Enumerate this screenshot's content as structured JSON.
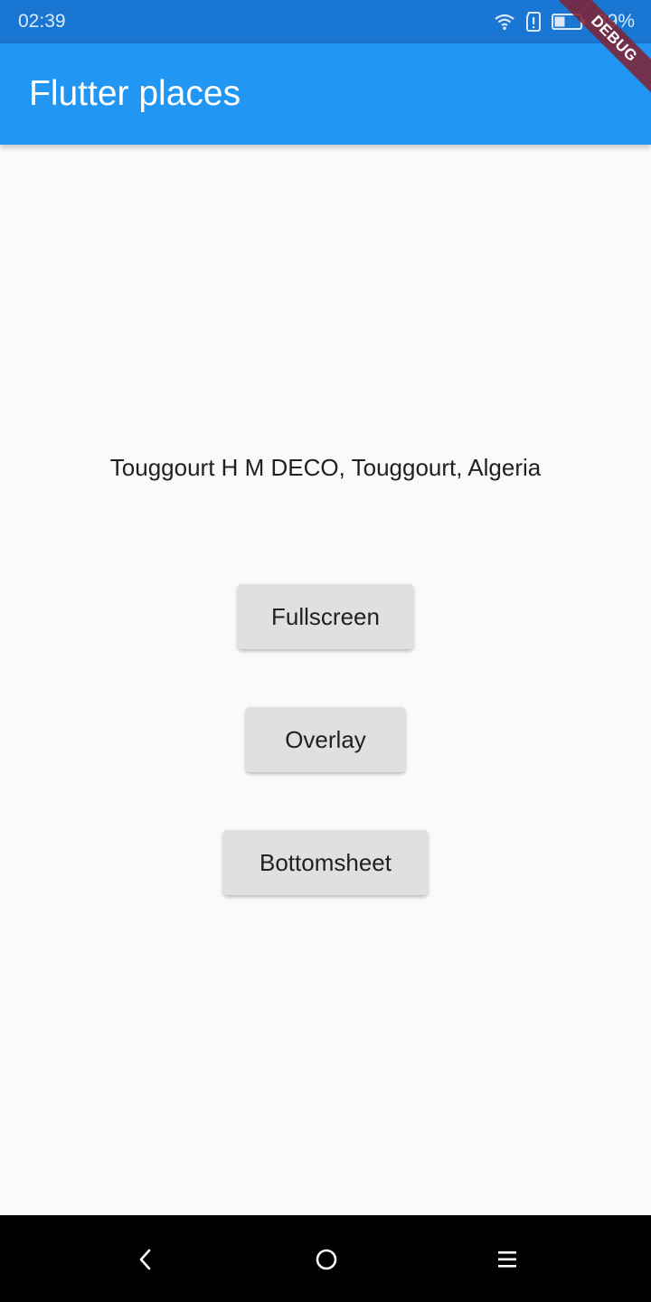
{
  "status_bar": {
    "time": "02:39",
    "battery_percent": "39%",
    "icons": [
      "wifi-icon",
      "sim-alert-icon",
      "battery-icon"
    ],
    "background": "#1976d2"
  },
  "app_bar": {
    "title": "Flutter places",
    "background": "#2196f3"
  },
  "debug_banner": {
    "label": "DEBUG"
  },
  "main": {
    "place_text": "Touggourt H M DECO, Touggourt, Algeria",
    "buttons": [
      {
        "label": "Fullscreen"
      },
      {
        "label": "Overlay"
      },
      {
        "label": "Bottomsheet"
      }
    ]
  },
  "nav_bar": {
    "icons": [
      "back-icon",
      "home-icon",
      "menu-icon"
    ]
  }
}
